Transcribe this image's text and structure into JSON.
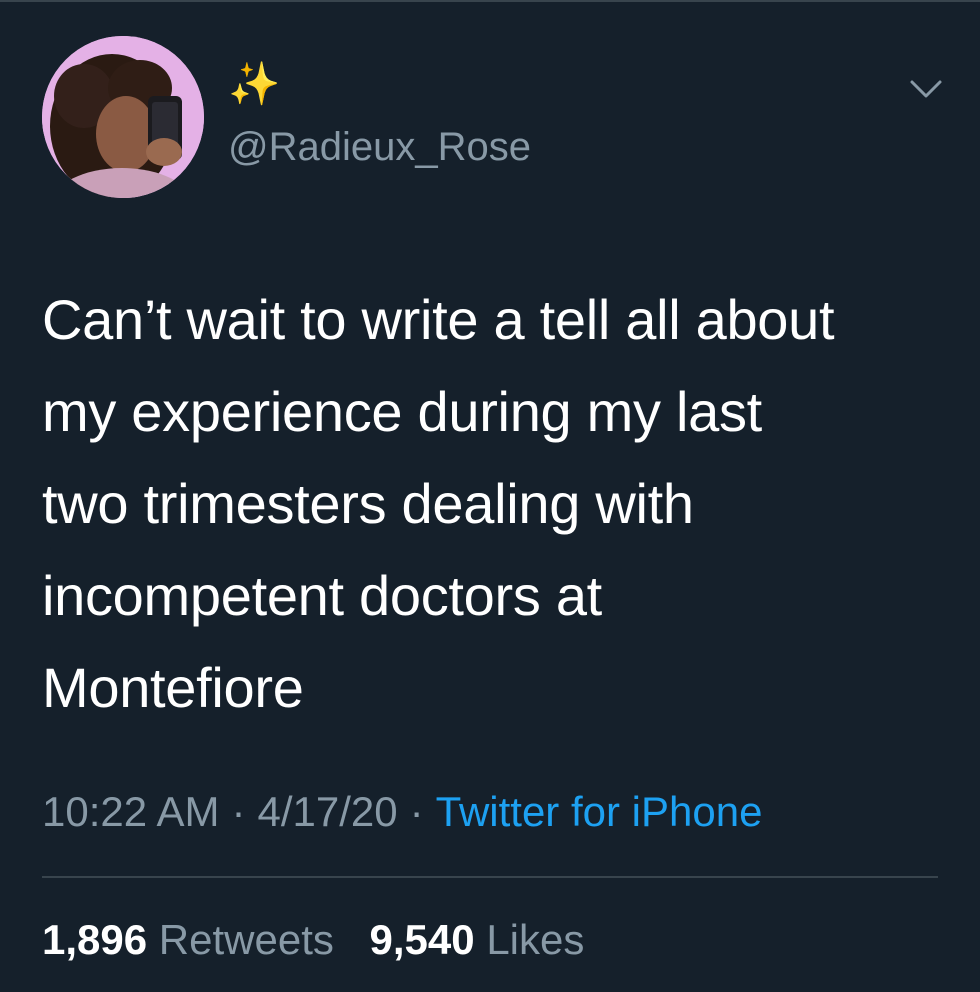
{
  "user": {
    "display_name": "✨",
    "handle": "@Radieux_Rose"
  },
  "tweet": {
    "text": "Can’t wait to write a tell all about\nmy experience during my last\ntwo trimesters dealing with\nincompetent doctors at\nMontefiore"
  },
  "meta": {
    "time": "10:22 AM",
    "separator": "·",
    "date": "4/17/20",
    "source": "Twitter for iPhone"
  },
  "stats": {
    "retweets_count": "1,896",
    "retweets_label": "Retweets",
    "likes_count": "9,540",
    "likes_label": "Likes"
  },
  "icons": {
    "more": "chevron-down-icon"
  },
  "colors": {
    "background": "#15202b",
    "text": "#ffffff",
    "secondary_text": "#8899a6",
    "link": "#1da1f2",
    "divider": "#38444d"
  }
}
